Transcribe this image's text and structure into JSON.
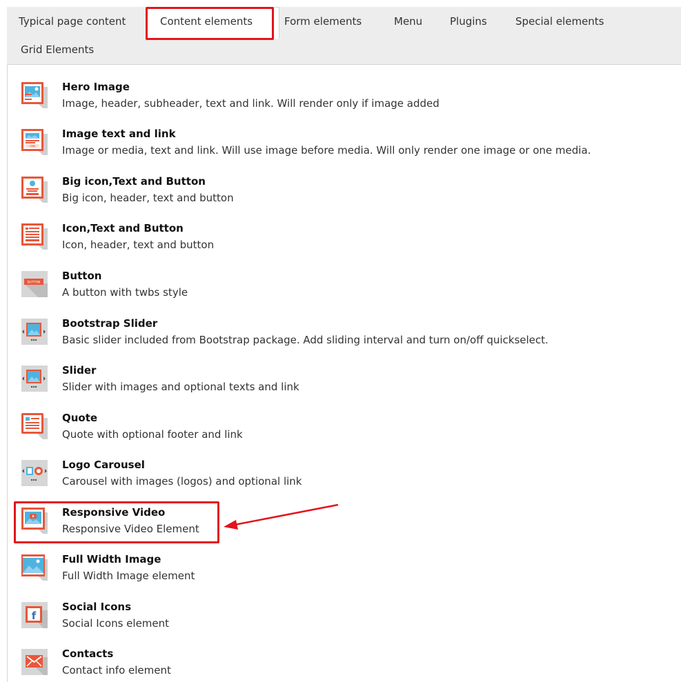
{
  "tabs": [
    {
      "label": "Typical page content"
    },
    {
      "label": "Content elements"
    },
    {
      "label": "Form elements"
    },
    {
      "label": "Menu"
    },
    {
      "label": "Plugins"
    },
    {
      "label": "Special elements"
    },
    {
      "label": "Grid Elements"
    }
  ],
  "active_tab": "Content elements",
  "items": [
    {
      "title": "Hero Image",
      "desc": "Image, header, subheader, text and link. Will render only if image added",
      "icon": "hero-image-icon"
    },
    {
      "title": "Image text and link",
      "desc": "Image or media, text and link. Will use image before media. Will only render one image or one media.",
      "icon": "image-text-link-icon"
    },
    {
      "title": "Big icon,Text and Button",
      "desc": "Big icon, header, text and button",
      "icon": "big-icon-text-button-icon"
    },
    {
      "title": "Icon,Text and Button",
      "desc": "Icon, header, text and button",
      "icon": "icon-text-button-icon"
    },
    {
      "title": "Button",
      "desc": "A button with twbs style",
      "icon": "button-icon"
    },
    {
      "title": "Bootstrap Slider",
      "desc": "Basic slider included from Bootstrap package. Add sliding interval and turn on/off quickselect.",
      "icon": "bootstrap-slider-icon"
    },
    {
      "title": "Slider",
      "desc": "Slider with images and optional texts and link",
      "icon": "slider-icon"
    },
    {
      "title": "Quote",
      "desc": "Quote with optional footer and link",
      "icon": "quote-icon"
    },
    {
      "title": "Logo Carousel",
      "desc": "Carousel with images (logos) and optional link",
      "icon": "logo-carousel-icon"
    },
    {
      "title": "Responsive Video",
      "desc": "Responsive Video Element",
      "icon": "responsive-video-icon"
    },
    {
      "title": "Full Width Image",
      "desc": "Full Width Image element",
      "icon": "full-width-image-icon"
    },
    {
      "title": "Social Icons",
      "desc": "Social Icons element",
      "icon": "social-icons-icon"
    },
    {
      "title": "Contacts",
      "desc": "Contact info element",
      "icon": "contacts-icon"
    }
  ],
  "icon_texts": {
    "button": "BUTTON",
    "link": "LINK",
    "facebook": "f"
  },
  "colors": {
    "accent_red": "#e3141b",
    "icon_orange": "#e8573a",
    "icon_blue": "#4fb3e0",
    "icon_gray": "#cfcfcf",
    "tabbar_bg": "#ededed"
  }
}
